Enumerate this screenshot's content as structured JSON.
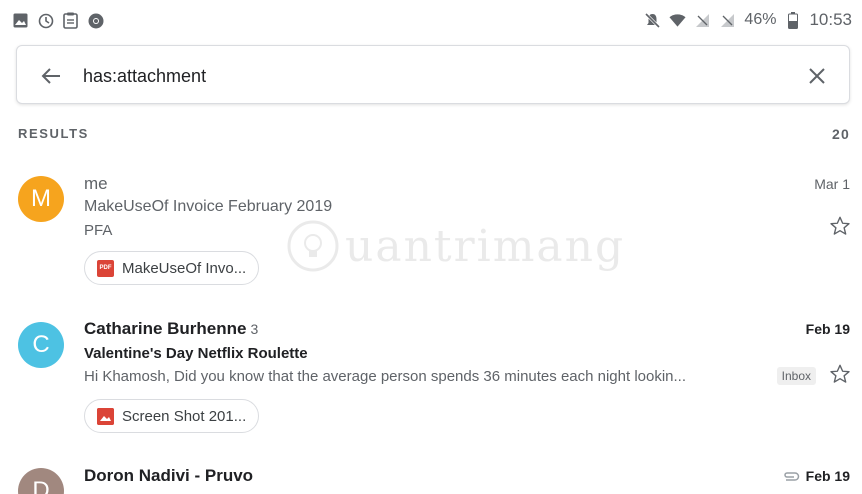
{
  "status_bar": {
    "left_icons": [
      "image-icon",
      "clock-icon",
      "clipboard-icon",
      "chrome-icon"
    ],
    "right_icons": [
      "mute-icon",
      "wifi-icon",
      "signal-icon",
      "signal-icon"
    ],
    "battery": "46%",
    "time": "10:53"
  },
  "search": {
    "query": "has:attachment",
    "back_icon": "arrow-back-icon",
    "clear_icon": "close-icon"
  },
  "results": {
    "label": "RESULTS",
    "count": "20"
  },
  "emails": [
    {
      "avatar_letter": "M",
      "avatar_color": "#f6a41e",
      "sender": "me",
      "thread_count": "",
      "subject": "MakeUseOf Invoice February 2019",
      "snippet": "PFA",
      "date": "Mar 1",
      "unread": false,
      "attachment": {
        "name": "MakeUseOf Invo...",
        "type": "pdf",
        "icon_text": "PDF"
      }
    },
    {
      "avatar_letter": "C",
      "avatar_color": "#4dc2e3",
      "sender": "Catharine Burhenne",
      "thread_count": "3",
      "subject": "Valentine's Day Netflix Roulette",
      "snippet": "Hi Khamosh, Did you know that the average person spends 36 minutes each  night lookin...",
      "label": "Inbox",
      "date": "Feb 19",
      "unread": true,
      "attachment": {
        "name": "Screen Shot 201...",
        "type": "image"
      }
    },
    {
      "avatar_letter": "D",
      "avatar_color": "#a1887f",
      "sender": "Doron Nadivi - Pruvo",
      "date": "Feb 19",
      "unread": true,
      "has_attachment_icon": "paperclip-icon"
    }
  ],
  "watermark": {
    "text": "uantrimang"
  },
  "colors": {
    "text_primary": "#202124",
    "text_secondary": "#5f6368",
    "attachment_icon": "#db4437",
    "border": "#dadce0"
  }
}
